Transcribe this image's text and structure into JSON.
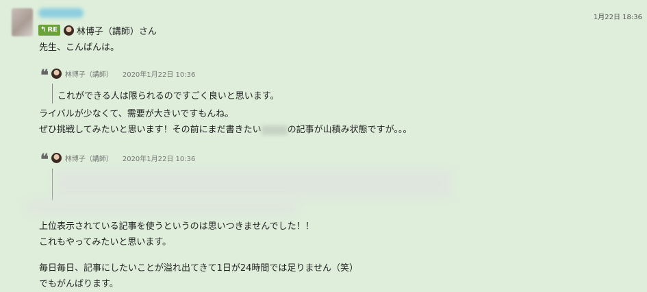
{
  "message": {
    "timestamp": "1月22日 18:36",
    "reply": {
      "badge": "RE",
      "to": "林博子（講師）さん"
    },
    "greeting": "先生、こんばんは。",
    "quote1": {
      "author": "林博子（講師）",
      "date": "2020年1月22日 10:36",
      "text": "これができる人は限られるのですごく良いと思います。"
    },
    "para1_line1": "ライバルが少なくて、需要が大きいですもんね。",
    "para1_line2_a": "ぜひ挑戦してみたいと思います！その前にまだ書きたい",
    "para1_line2_b": "の記事が山積み状態ですが。。。",
    "quote2": {
      "author": "林博子（講師）",
      "date": "2020年1月22日 10:36"
    },
    "para2_line1": "上位表示されている記事を使うというのは思いつきませんでした！！",
    "para2_line2": "これもやってみたいと思います。",
    "para3_line1": "毎日毎日、記事にしたいことが溢れ出てきて1日が24時間では足りません（笑）",
    "para3_line2": "でもがんばります。"
  }
}
